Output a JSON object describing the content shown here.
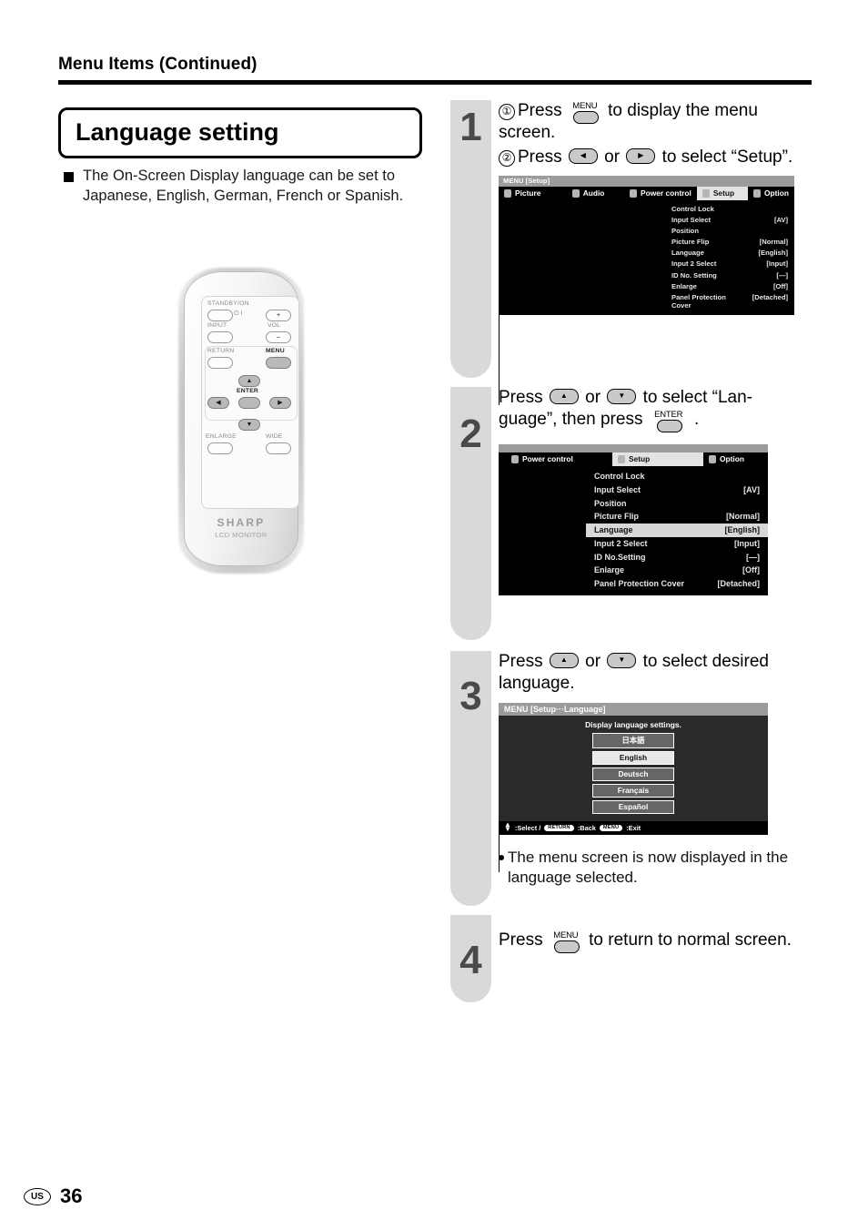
{
  "header": {
    "title": "Menu Items (Continued)"
  },
  "left": {
    "section_title": "Language setting",
    "bullet": "The On-Screen Display language can be set to Japanese, English, German, French or Spanish."
  },
  "remote": {
    "labels": {
      "standby": "STANDBY/ON",
      "input": "INPUT",
      "vol": "VOL",
      "vol_plus": "+",
      "vol_minus": "–",
      "return": "RETURN",
      "menu": "MENU",
      "enter": "ENTER",
      "enlarge": "ENLARGE",
      "wide": "WIDE",
      "power_symbol": "⏻ I",
      "up": "▲",
      "down": "▼",
      "left": "◀",
      "right": "▶"
    },
    "brand": "SHARP",
    "product": "LCD MONITOR"
  },
  "steps": [
    {
      "number": "1",
      "sub1_num": "①",
      "sub1_a": "Press",
      "sub1_key": "MENU",
      "sub1_b": "to display the menu screen.",
      "sub2_num": "②",
      "sub2_a": "Press",
      "sub2_left": "◀",
      "sub2_or": "or",
      "sub2_right": "▶",
      "sub2_b": "to select “Setup”."
    },
    {
      "number": "2",
      "text_a": "Press",
      "key_up": "▲",
      "or": "or",
      "key_down": "▼",
      "text_b": "to select “Lan-",
      "text_c": "guage”, then press",
      "key_enter": "ENTER",
      "text_d": "."
    },
    {
      "number": "3",
      "text_a": "Press",
      "key_up": "▲",
      "or": "or",
      "key_down": "▼",
      "text_b": "to select desired language.",
      "note": "The menu screen is now displayed in the language selected."
    },
    {
      "number": "4",
      "text_a": "Press",
      "key_menu": "MENU",
      "text_b": "to return to normal screen."
    }
  ],
  "osd_step1": {
    "title": "MENU [Setup]",
    "tabs": [
      {
        "label": "Picture",
        "active": false
      },
      {
        "label": "Audio",
        "active": false
      },
      {
        "label": "Power control",
        "active": false
      },
      {
        "label": "Setup",
        "active": true
      },
      {
        "label": "Option",
        "active": false
      }
    ],
    "rows": [
      {
        "label": "Control Lock",
        "value": ""
      },
      {
        "label": "Input Select",
        "value": "[AV]"
      },
      {
        "label": "Position",
        "value": ""
      },
      {
        "label": "Picture Flip",
        "value": "[Normal]"
      },
      {
        "label": "Language",
        "value": "[English]"
      },
      {
        "label": "Input 2 Select",
        "value": "[Input]"
      },
      {
        "label": "ID No. Setting",
        "value": "[—]"
      },
      {
        "label": "Enlarge",
        "value": "[Off]"
      },
      {
        "label": "Panel Protection Cover",
        "value": "[Detached]"
      }
    ]
  },
  "osd_step2": {
    "tabs": [
      {
        "label": "Power control",
        "active": false
      },
      {
        "label": "Setup",
        "active": true
      },
      {
        "label": "Option",
        "active": false
      }
    ],
    "rows": [
      {
        "label": "Control Lock",
        "value": "",
        "selected": false
      },
      {
        "label": "Input Select",
        "value": "[AV]",
        "selected": false
      },
      {
        "label": "Position",
        "value": "",
        "selected": false
      },
      {
        "label": "Picture Flip",
        "value": "[Normal]",
        "selected": false
      },
      {
        "label": "Language",
        "value": "[English]",
        "selected": true
      },
      {
        "label": "Input 2 Select",
        "value": "[Input]",
        "selected": false
      },
      {
        "label": "ID No.Setting",
        "value": "[—]",
        "selected": false
      },
      {
        "label": "Enlarge",
        "value": "[Off]",
        "selected": false
      },
      {
        "label": "Panel Protection Cover",
        "value": "[Detached]",
        "selected": false
      }
    ]
  },
  "osd_step3": {
    "title": "MENU [Setup···Language]",
    "subtitle": "Display language settings.",
    "options": [
      {
        "label": "日本語",
        "selected": false
      },
      {
        "label": "English",
        "selected": true
      },
      {
        "label": "Deutsch",
        "selected": false
      },
      {
        "label": "Français",
        "selected": false
      },
      {
        "label": "Español",
        "selected": false
      }
    ],
    "footer": {
      "select": ":Select /",
      "return_key": "RETURN",
      "back": ":Back",
      "menu_key": "MENU",
      "exit": ":Exit"
    }
  },
  "footer": {
    "region": "US",
    "page": "36"
  }
}
